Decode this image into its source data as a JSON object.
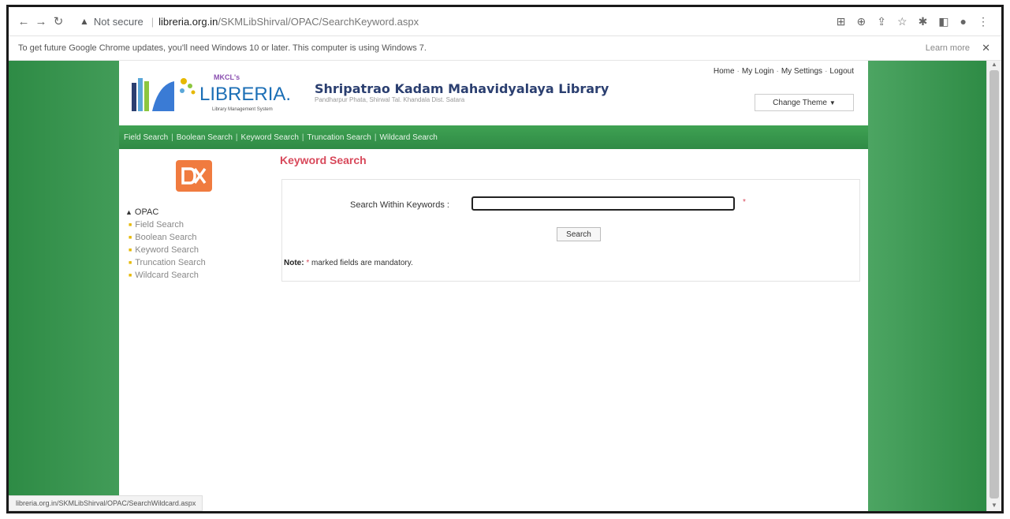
{
  "browser": {
    "security": "Not secure",
    "url_host": "libreria.org.in",
    "url_path": "/SKMLibShirval/OPAC/SearchKeyword.aspx"
  },
  "infobar": {
    "message": "To get future Google Chrome updates, you'll need Windows 10 or later. This computer is using Windows 7.",
    "learn_more": "Learn more",
    "close": "✕"
  },
  "header": {
    "logo_top": "MKCL's",
    "logo_main": "LIBRERIA.",
    "logo_sub": "Library Management System",
    "library_name": "Shripatrao Kadam Mahavidyalaya Library",
    "library_address": "Pandharpur Phata, Shirwal Tal. Khandala Dist. Satara",
    "links": [
      "Home",
      "My Login",
      "My Settings",
      "Logout"
    ],
    "theme_button": "Change Theme"
  },
  "navbar": [
    "Field Search",
    "Boolean Search",
    "Keyword Search",
    "Truncation Search",
    "Wildcard Search"
  ],
  "sidebar": {
    "section": "OPAC",
    "items": [
      "Field Search",
      "Boolean Search",
      "Keyword Search",
      "Truncation Search",
      "Wildcard Search"
    ]
  },
  "content": {
    "title": "Keyword Search",
    "field_label": "Search Within Keywords :",
    "field_value": "",
    "required_mark": "*",
    "search_button": "Search",
    "note_label": "Note:",
    "note_star": "*",
    "note_text": "marked fields are mandatory."
  },
  "status_url": "libreria.org.in/SKMLibShirval/OPAC/SearchWildcard.aspx",
  "colors": {
    "accent": "#d8495b",
    "navbar": "#3fa253",
    "title_blue": "#2b3f70"
  }
}
